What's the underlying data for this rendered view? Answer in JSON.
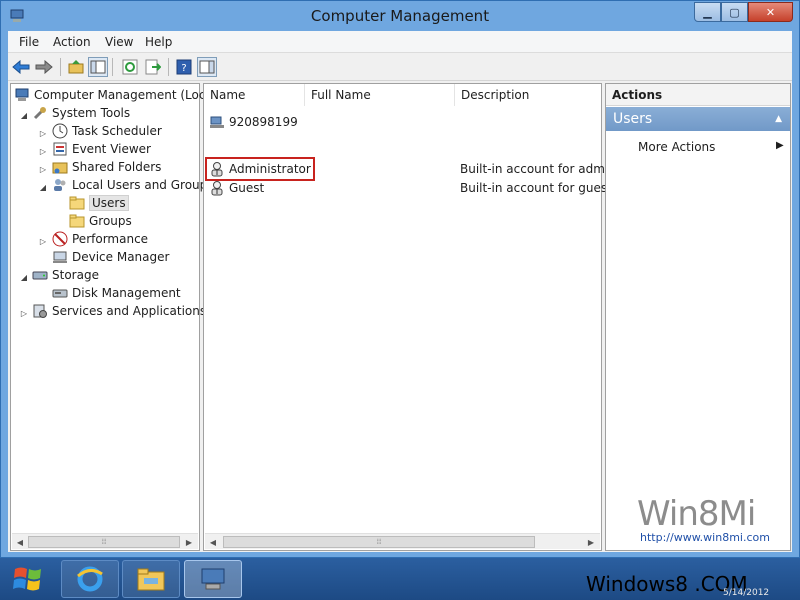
{
  "window": {
    "title": "Computer Management"
  },
  "menu": [
    "File",
    "Action",
    "View",
    "Help"
  ],
  "tree": {
    "root": "Computer Management (Local",
    "system_tools": "System Tools",
    "task_scheduler": "Task Scheduler",
    "event_viewer": "Event Viewer",
    "shared_folders": "Shared Folders",
    "local_users_groups": "Local Users and Groups",
    "users": "Users",
    "groups": "Groups",
    "performance": "Performance",
    "device_manager": "Device Manager",
    "storage": "Storage",
    "disk_management": "Disk Management",
    "services_apps": "Services and Applications"
  },
  "list": {
    "columns": [
      "Name",
      "Full Name",
      "Description"
    ],
    "rows": [
      {
        "name": "920898199",
        "full_name": "",
        "description": ""
      },
      {
        "name": "Administrator",
        "full_name": "",
        "description": "Built-in account for admir"
      },
      {
        "name": "Guest",
        "full_name": "",
        "description": "Built-in account for guest"
      }
    ]
  },
  "actions": {
    "header": "Actions",
    "group": "Users",
    "more": "More Actions"
  },
  "watermark": {
    "logo": "Win8Mi",
    "url": "http://www.win8mi.com"
  },
  "taskbar": {
    "overlay_text": "Windows8 .COM",
    "tray_sub": "5/14/2012"
  },
  "colors": {
    "title_bar": "#6fa7e0",
    "action_group": "#7f a3d0",
    "highlight": "#c8231e"
  }
}
